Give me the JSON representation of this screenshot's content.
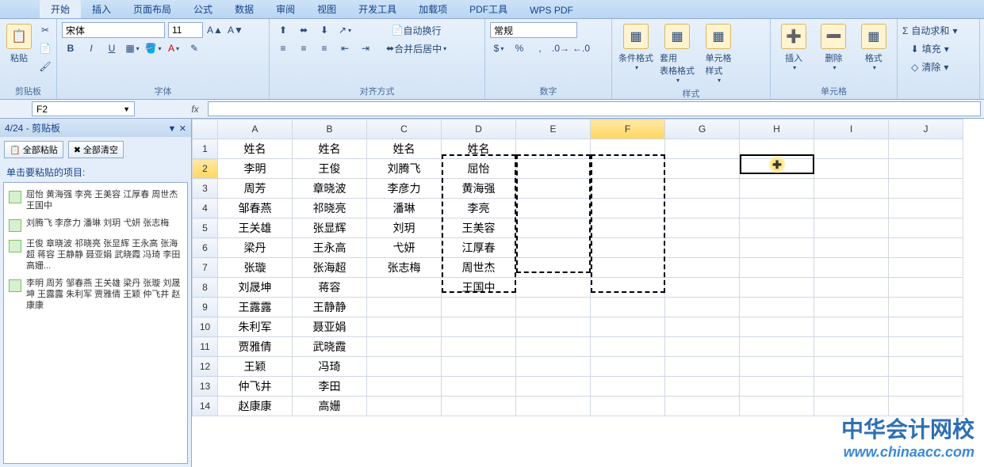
{
  "tabs": [
    "开始",
    "插入",
    "页面布局",
    "公式",
    "数据",
    "审阅",
    "视图",
    "开发工具",
    "加载项",
    "PDF工具",
    "WPS PDF"
  ],
  "active_tab": 0,
  "ribbon": {
    "clipboard": {
      "paste": "粘贴",
      "label": "剪贴板"
    },
    "font": {
      "name": "宋体",
      "size": "11",
      "label": "字体"
    },
    "align": {
      "wrap": "自动换行",
      "merge": "合并后居中",
      "label": "对齐方式"
    },
    "number": {
      "format": "常规",
      "label": "数字"
    },
    "styles": {
      "cond": "条件格式",
      "table": "套用\n表格格式",
      "cell": "单元格\n样式",
      "label": "样式"
    },
    "cells": {
      "insert": "插入",
      "delete": "删除",
      "format": "格式",
      "label": "单元格"
    },
    "editing": {
      "sum": "自动求和",
      "fill": "填充",
      "clear": "清除"
    }
  },
  "namebox": "F2",
  "clipboard_pane": {
    "title": "4/24 - 剪贴板",
    "paste_all": "全部粘贴",
    "clear_all": "全部清空",
    "hint": "单击要粘贴的项目:",
    "items": [
      "屈怡 黄海强 李亮 王美容 江厚春 周世杰 王国中",
      "刘腾飞 李彦力 潘琳 刘玥 弋妍 张志梅",
      "王俊 章晓波 祁晓亮 张显辉 王永高 张海超 蒋容 王静静 聂亚娟 武晓霞 冯琦 李田 高姗...",
      "李明 周芳 邹春燕 王关雄 梁丹 张璇 刘晟坤 王露露 朱利军 贾雅倩 王颖 仲飞井 赵康康"
    ]
  },
  "columns": [
    "A",
    "B",
    "C",
    "D",
    "E",
    "F",
    "G",
    "H",
    "I",
    "J"
  ],
  "selected_col": "F",
  "selected_row": 2,
  "chart_data": {
    "type": "table",
    "headers": [
      "姓名",
      "姓名",
      "姓名",
      "姓名"
    ],
    "rows": [
      [
        "李明",
        "王俊",
        "刘腾飞",
        "屈怡"
      ],
      [
        "周芳",
        "章晓波",
        "李彦力",
        "黄海强"
      ],
      [
        "邹春燕",
        "祁晓亮",
        "潘琳",
        "李亮"
      ],
      [
        "王关雄",
        "张显辉",
        "刘玥",
        "王美容"
      ],
      [
        "梁丹",
        "王永高",
        "弋妍",
        "江厚春"
      ],
      [
        "张璇",
        "张海超",
        "张志梅",
        "周世杰"
      ],
      [
        "刘晟坤",
        "蒋容",
        "",
        "王国中"
      ],
      [
        "王露露",
        "王静静",
        "",
        ""
      ],
      [
        "朱利军",
        "聂亚娟",
        "",
        ""
      ],
      [
        "贾雅倩",
        "武晓霞",
        "",
        ""
      ],
      [
        "王颖",
        "冯琦",
        "",
        ""
      ],
      [
        "仲飞井",
        "李田",
        "",
        ""
      ],
      [
        "赵康康",
        "高姗",
        "",
        ""
      ]
    ]
  },
  "watermark": {
    "l1": "中华会计网校",
    "l2": "www.chinaacc.com"
  }
}
